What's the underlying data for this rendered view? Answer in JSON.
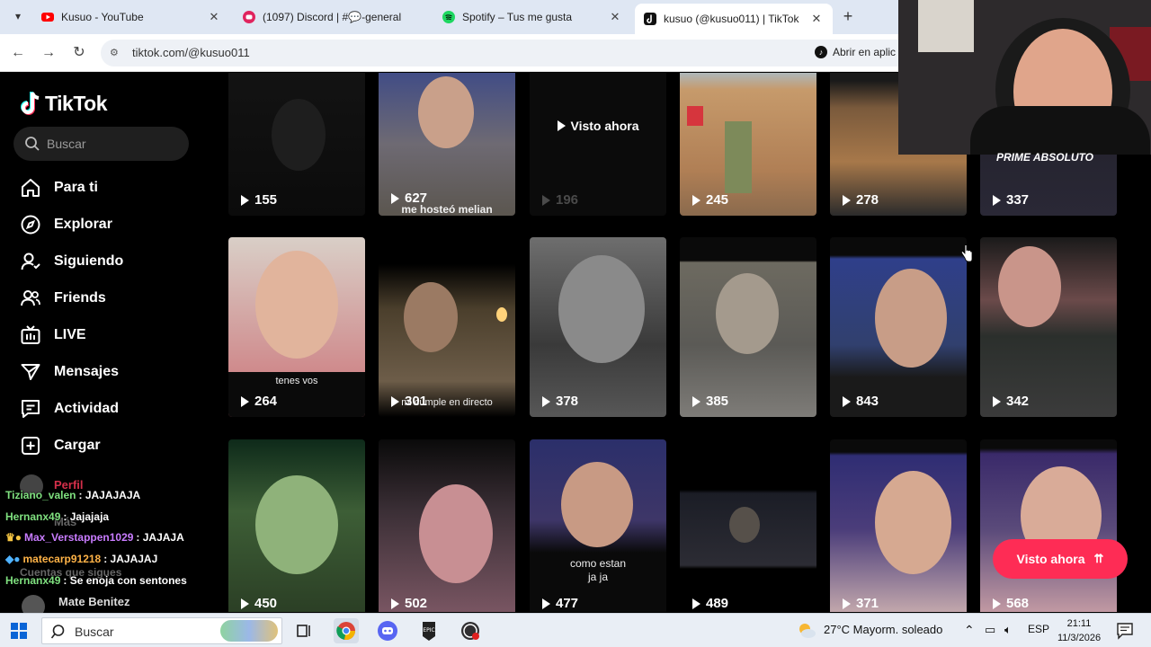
{
  "browser": {
    "tabs": [
      {
        "title": "Kusuo - YouTube",
        "favicon": "youtube-icon",
        "color": "#ff0000"
      },
      {
        "title": "(1097) Discord | #💬-general | ",
        "favicon": "discord-icon",
        "color": "#5865f2"
      },
      {
        "title": "Spotify – Tus me gusta",
        "favicon": "spotify-icon",
        "color": "#1ed760"
      },
      {
        "title": "kusuo (@kusuo011) | TikTok",
        "favicon": "tiktok-icon",
        "color": "#111111",
        "active": true
      }
    ],
    "url": "tiktok.com/@kusuo011",
    "open_app_label": "Abrir en aplic"
  },
  "tiktok": {
    "logo_text": "TikTok",
    "search_placeholder": "Buscar",
    "nav": [
      {
        "label": "Para ti",
        "icon": "home-icon"
      },
      {
        "label": "Explorar",
        "icon": "compass-icon"
      },
      {
        "label": "Siguiendo",
        "icon": "following-icon"
      },
      {
        "label": "Friends",
        "icon": "friends-icon"
      },
      {
        "label": "LIVE",
        "icon": "live-icon"
      },
      {
        "label": "Mensajes",
        "icon": "messages-icon"
      },
      {
        "label": "Actividad",
        "icon": "activity-icon"
      },
      {
        "label": "Cargar",
        "icon": "upload-icon"
      }
    ],
    "ghost_profile": "Perfil",
    "ghost_more": "Más",
    "ghost_following": "Cuentas que sigues",
    "ghost_account": "Mate Benitez",
    "watched_label": "Visto ahora",
    "seen_button": "Visto ahora",
    "videos": [
      {
        "views": "155"
      },
      {
        "views": "627",
        "caption": "me hosteó melian"
      },
      {
        "views": "196",
        "watched": true
      },
      {
        "views": "245"
      },
      {
        "views": "278"
      },
      {
        "views": "337"
      },
      {
        "views": "264",
        "caption": "tenes vos"
      },
      {
        "views": "301",
        "caption": "mi cumple en directo"
      },
      {
        "views": "378"
      },
      {
        "views": "385"
      },
      {
        "views": "843"
      },
      {
        "views": "342"
      },
      {
        "views": "450"
      },
      {
        "views": "502"
      },
      {
        "views": "477",
        "caption": "como estan\nja ja"
      },
      {
        "views": "489"
      },
      {
        "views": "371"
      },
      {
        "views": "568"
      }
    ]
  },
  "webcam": {
    "tag": "PRIME ABSOLUTO"
  },
  "chat": [
    {
      "user": "Tiziano_valen",
      "msg": ": JAJAJAJA",
      "color": "#7fe07f"
    },
    {
      "user": "Hernanx49",
      "msg": ": Jajajaja",
      "color": "#7fe07f"
    },
    {
      "user": "Max_Verstappen1029",
      "msg": ": JAJAJA",
      "color": "#c97cff",
      "badge": true
    },
    {
      "user": "matecarp91218",
      "msg": ": JAJAJAJ",
      "color": "#ffb347",
      "badge": true
    },
    {
      "user": "Hernanx49",
      "msg": ": Se enoja con sentones",
      "color": "#7fe07f"
    }
  ],
  "taskbar": {
    "search_placeholder": "Buscar",
    "weather": "27°C  Mayorm. soleado",
    "language": "ESP",
    "time": "21:11",
    "date": "11/3/2026"
  }
}
